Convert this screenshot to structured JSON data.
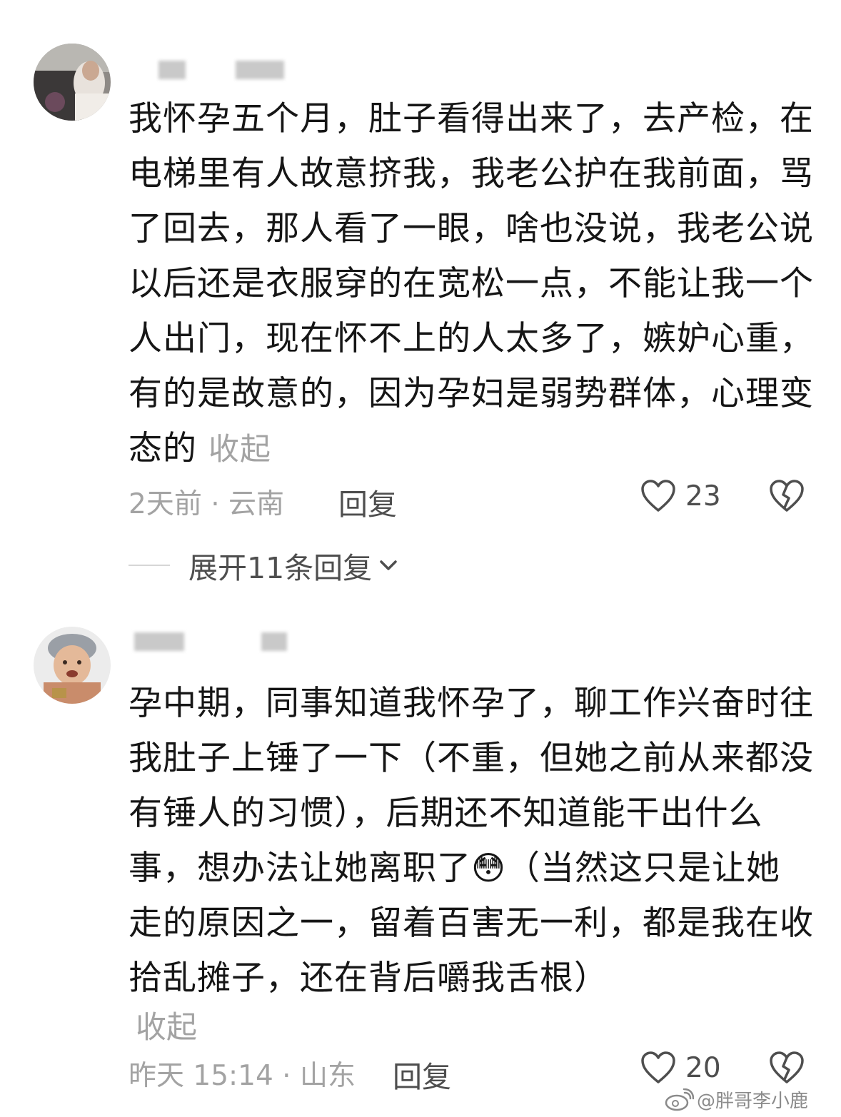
{
  "comments": [
    {
      "text": "我怀孕五个月，肚子看得出来了，去产检，在电梯里有人故意挤我，我老公护在我前面，骂了回去，那人看了一眼，啥也没说，我老公说以后还是衣服穿的在宽松一点，不能让我一个人出门，现在怀不上的人太多了，嫉妒心重，有的是故意的，因为孕妇是弱势群体，心理变态的",
      "collapse_label": "收起",
      "meta": "2天前 · 云南",
      "reply_label": "回复",
      "likes": "23",
      "expand_replies_label": "展开11条回复"
    },
    {
      "text_part1": "孕中期，同事知道我怀孕了，聊工作兴奋时往我肚子上锤了一下（不重，但她之前从来都没有锤人的习惯），后期还不知道能干出什么事，想办法让她离职了",
      "emoji": "😳",
      "text_part2": "（当然这只是让她走的原因之一，留着百害无一利，都是我在收拾乱摊子，还在背后嚼我舌根）",
      "collapse_label": "收起",
      "meta": "昨天 15:14 · 山东",
      "reply_label": "回复",
      "likes": "20"
    }
  ],
  "watermark": "@胖哥李小鹿",
  "colors": {
    "text": "#161616",
    "muted": "#a3a3a3",
    "secondary": "#4e4e4e",
    "background": "#ffffff"
  },
  "icons": [
    "heart-outline-icon",
    "broken-heart-icon",
    "chevron-down-icon",
    "weibo-logo-icon"
  ]
}
